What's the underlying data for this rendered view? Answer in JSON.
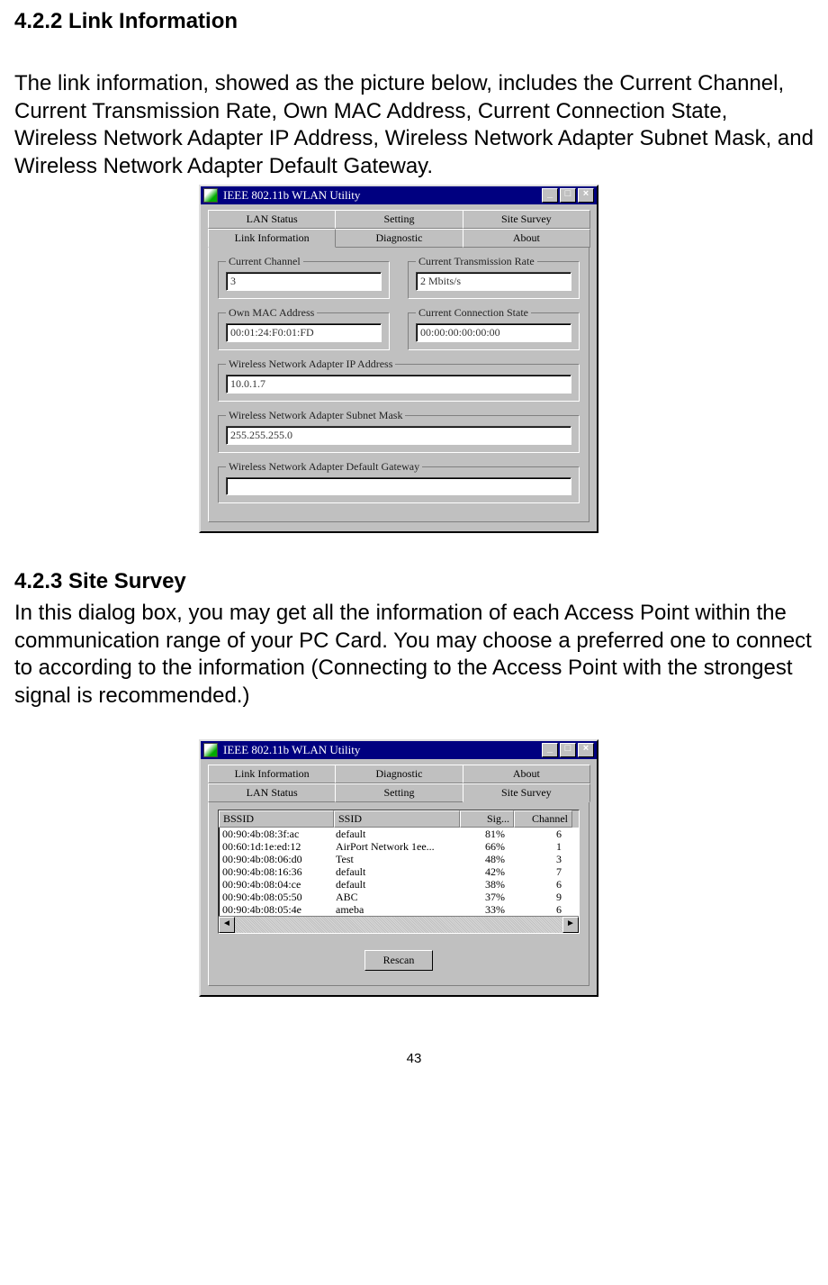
{
  "section1": {
    "heading": "4.2.2 Link Information",
    "body": "The link information, showed as the picture below, includes the Current Channel, Current Transmission Rate, Own MAC Address, Current Connection State, Wireless Network Adapter IP Address, Wireless Network Adapter Subnet Mask, and Wireless Network Adapter Default Gateway."
  },
  "dialog1": {
    "title": "IEEE 802.11b WLAN Utility",
    "tabs_back": [
      "LAN Status",
      "Setting",
      "Site Survey"
    ],
    "tabs_front": [
      "Link Information",
      "Diagnostic",
      "About"
    ],
    "active_tab": "Link Information",
    "fields": {
      "current_channel": {
        "label": "Current Channel",
        "value": "3"
      },
      "tx_rate": {
        "label": "Current Transmission Rate",
        "value": "2 Mbits/s"
      },
      "own_mac": {
        "label": "Own MAC Address",
        "value": "00:01:24:F0:01:FD"
      },
      "conn_state": {
        "label": "Current Connection State",
        "value": "00:00:00:00:00:00"
      },
      "ip": {
        "label": "Wireless Network Adapter IP Address",
        "value": "10.0.1.7"
      },
      "subnet": {
        "label": "Wireless Network Adapter Subnet Mask",
        "value": "255.255.255.0"
      },
      "gateway": {
        "label": "Wireless Network Adapter Default Gateway",
        "value": ""
      }
    }
  },
  "section2": {
    "heading": "4.2.3 Site Survey",
    "body": "In this dialog box, you may get all the information of each Access Point within the communication range of your PC Card. You may choose a preferred one to connect to according to the information (Connecting to the Access Point with the strongest signal is recommended.)"
  },
  "dialog2": {
    "title": "IEEE 802.11b WLAN Utility",
    "tabs_back": [
      "Link Information",
      "Diagnostic",
      "About"
    ],
    "tabs_front": [
      "LAN Status",
      "Setting",
      "Site Survey"
    ],
    "active_tab": "Site Survey",
    "columns": [
      "BSSID",
      "SSID",
      "Sig...",
      "Channel"
    ],
    "rows": [
      {
        "bssid": "00:90:4b:08:3f:ac",
        "ssid": "default",
        "sig": "81%",
        "chan": "6"
      },
      {
        "bssid": "00:60:1d:1e:ed:12",
        "ssid": "AirPort Network 1ee...",
        "sig": "66%",
        "chan": "1"
      },
      {
        "bssid": "00:90:4b:08:06:d0",
        "ssid": "Test",
        "sig": "48%",
        "chan": "3"
      },
      {
        "bssid": "00:90:4b:08:16:36",
        "ssid": "default",
        "sig": "42%",
        "chan": "7"
      },
      {
        "bssid": "00:90:4b:08:04:ce",
        "ssid": "default",
        "sig": "38%",
        "chan": "6"
      },
      {
        "bssid": "00:90:4b:08:05:50",
        "ssid": "ABC",
        "sig": "37%",
        "chan": "9"
      },
      {
        "bssid": "00:90:4b:08:05:4e",
        "ssid": "ameba",
        "sig": "33%",
        "chan": "6"
      }
    ],
    "rescan_label": "Rescan"
  },
  "page_number": "43",
  "win_controls": {
    "min": "_",
    "max": "□",
    "close": "×"
  }
}
